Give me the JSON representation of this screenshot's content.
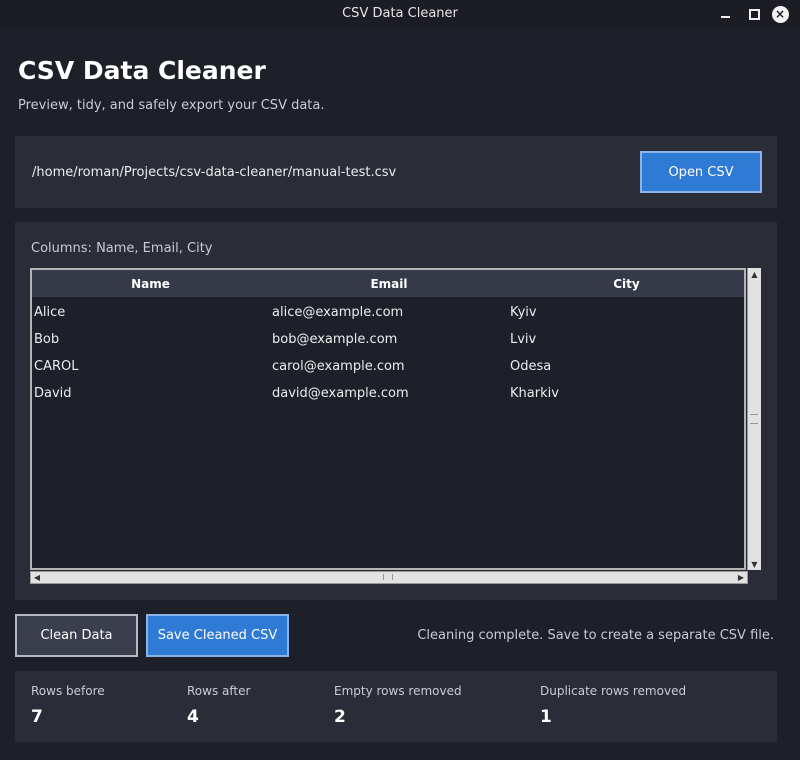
{
  "window": {
    "title": "CSV Data Cleaner",
    "controls": {
      "minimize_icon": "minimize-icon",
      "maximize_icon": "maximize-icon",
      "close_icon": "close-icon",
      "close_glyph": "×"
    }
  },
  "header": {
    "title": "CSV Data Cleaner",
    "subtitle": "Preview, tidy, and safely export your CSV data."
  },
  "file": {
    "path": "/home/roman/Projects/csv-data-cleaner/manual-test.csv",
    "open_label": "Open CSV"
  },
  "preview": {
    "columns_label": "Columns: Name, Email, City",
    "headers": [
      "Name",
      "Email",
      "City"
    ],
    "rows": [
      [
        "Alice",
        "alice@example.com",
        "Kyiv"
      ],
      [
        "Bob",
        "bob@example.com",
        "Lviv"
      ],
      [
        "CAROL",
        "carol@example.com",
        "Odesa"
      ],
      [
        "David",
        "david@example.com",
        "Kharkiv"
      ]
    ]
  },
  "actions": {
    "clean_label": "Clean Data",
    "save_label": "Save Cleaned CSV",
    "status": "Cleaning complete. Save to create a separate CSV file."
  },
  "stats": [
    {
      "label": "Rows before",
      "value": "7"
    },
    {
      "label": "Rows after",
      "value": "4"
    },
    {
      "label": "Empty rows removed",
      "value": "2"
    },
    {
      "label": "Duplicate rows removed",
      "value": "1"
    }
  ],
  "colors": {
    "background": "#1e2029",
    "panel": "#2a2d38",
    "accent": "#2f7ad4",
    "header_row": "#363948"
  }
}
